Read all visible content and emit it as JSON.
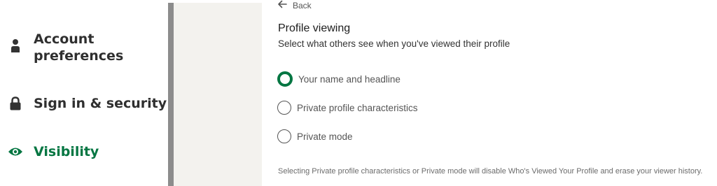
{
  "sidebar": {
    "items": [
      {
        "label": "Account\npreferences",
        "icon": "person-icon",
        "active": false
      },
      {
        "label": "Sign in & security",
        "icon": "lock-icon",
        "active": false
      },
      {
        "label": "Visibility",
        "icon": "eye-icon",
        "active": true
      }
    ]
  },
  "main": {
    "back_label": "Back",
    "title": "Profile viewing",
    "subtitle": "Select what others see when you've viewed their profile",
    "options": [
      {
        "label": "Your name and headline",
        "selected": true
      },
      {
        "label": "Private profile characteristics",
        "selected": false
      },
      {
        "label": "Private mode",
        "selected": false
      }
    ],
    "note": "Selecting Private profile characteristics or Private mode will disable Who's Viewed Your Profile and erase your viewer history."
  },
  "colors": {
    "accent": "#057642",
    "nav_text": "#2f2f2f",
    "divider": "#8c8c8c",
    "gutter": "#f3f2ee"
  }
}
